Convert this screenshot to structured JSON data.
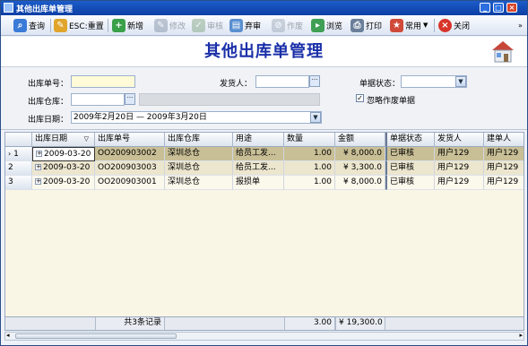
{
  "window": {
    "title": "其他出库单管理",
    "min": "_",
    "max": "□",
    "close": "×"
  },
  "toolbar": {
    "query": "查询",
    "reset": "ESC:重置",
    "add": "新增",
    "edit": "修改",
    "audit": "审核",
    "unaudit": "弃审",
    "void": "作废",
    "browse": "浏览",
    "print": "打印",
    "common": "常用",
    "close": "关闭",
    "overflow": "»"
  },
  "page": {
    "title": "其他出库单管理"
  },
  "filters": {
    "order_no_label": "出库单号：",
    "order_no_value": "",
    "shipper_label": "发货人：",
    "shipper_value": "",
    "status_label": "单据状态：",
    "status_value": "",
    "warehouse_label": "出库仓库：",
    "warehouse_value": "",
    "ignore_void_label": "忽略作废单据",
    "ignore_void_checked": true,
    "date_label": "出库日期：",
    "date_value": "2009年2月20日 — 2009年3月20日"
  },
  "grid": {
    "columns": [
      "出库日期",
      "出库单号",
      "出库仓库",
      "用途",
      "数量",
      "金额",
      "单据状态",
      "发货人",
      "建单人"
    ],
    "rows": [
      {
        "idx": "1",
        "date": "2009-03-20",
        "no": "OO200903002",
        "wh": "深圳总仓",
        "use": "给员工发...",
        "qty": "1.00",
        "amt": "¥ 8,000.0",
        "status": "已审核",
        "shipper": "用户129",
        "creator": "用户129"
      },
      {
        "idx": "2",
        "date": "2009-03-20",
        "no": "OO200903003",
        "wh": "深圳总仓",
        "use": "给员工发...",
        "qty": "1.00",
        "amt": "¥ 3,300.0",
        "status": "已审核",
        "shipper": "用户129",
        "creator": "用户129"
      },
      {
        "idx": "3",
        "date": "2009-03-20",
        "no": "OO200903001",
        "wh": "深圳总仓",
        "use": "报损单",
        "qty": "1.00",
        "amt": "¥ 8,000.0",
        "status": "已审核",
        "shipper": "用户129",
        "creator": "用户129"
      }
    ],
    "footer": {
      "count": "共3条记录",
      "qty_total": "3.00",
      "amt_total": "¥ 19,300.0"
    }
  }
}
